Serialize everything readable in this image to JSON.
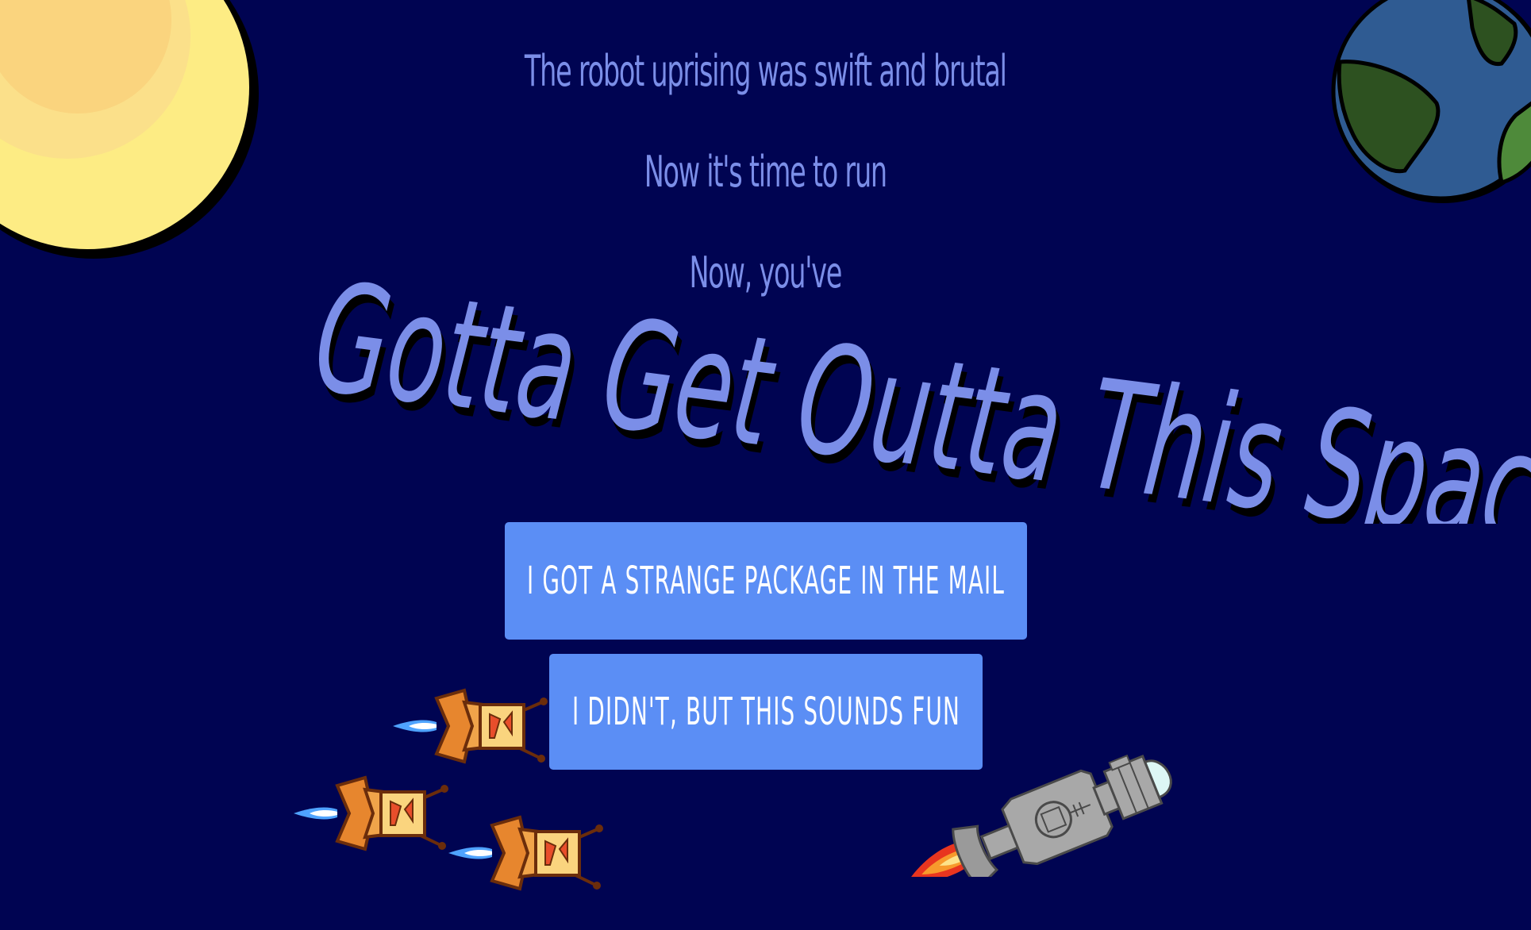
{
  "intro": {
    "line1": "The robot uprising was swift and brutal",
    "line2": "Now it's time to run",
    "line3": "Now, you've"
  },
  "title": "Gotta Get Outta This Space",
  "buttons": {
    "strange_package": "I got a strange package in the mail",
    "sounds_fun": "I didn't, but this sounds fun"
  },
  "colors": {
    "background": "#000452",
    "text": "#7b8ee8",
    "title": "#7b8ee8",
    "button": "#5b8ef5",
    "button_text": "#ffffff",
    "sun_outer": "#fdec84",
    "sun_inner": "#fad47e",
    "earth_ocean": "#2f5b92",
    "earth_land": "#2d5120"
  },
  "icons": {
    "sun": "sun-illustration",
    "earth": "earth-illustration",
    "robots": "robot-ship-sprites",
    "player": "player-spaceship-sprite"
  }
}
